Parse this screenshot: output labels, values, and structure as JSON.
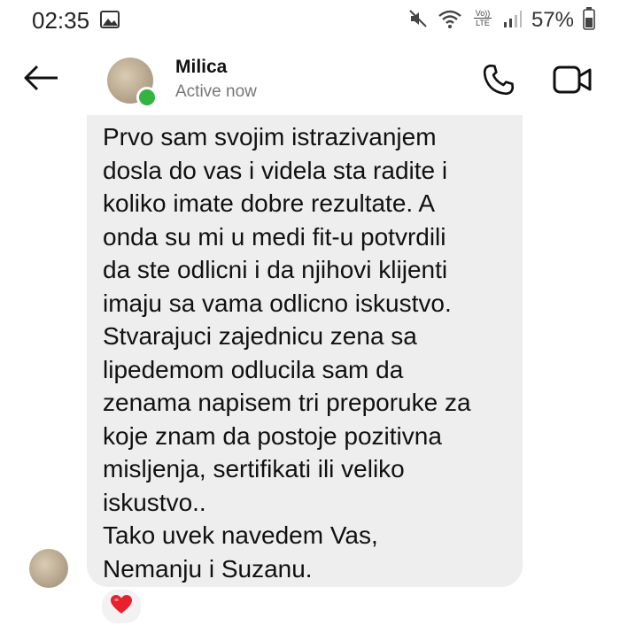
{
  "status_bar": {
    "time": "02:35",
    "battery_percent": "57%",
    "icons": [
      "gallery-icon",
      "mute-icon",
      "wifi-icon",
      "volte-icon",
      "signal-icon",
      "battery-icon"
    ]
  },
  "header": {
    "contact_name": "Milica",
    "status": "Active now",
    "online": true,
    "icons": [
      "back-arrow-icon",
      "phone-icon",
      "video-camera-icon"
    ]
  },
  "message": {
    "lines": [
      "Prvo sam svojim istrazivanjem",
      "dosla do vas i videla sta radite i",
      "koliko imate dobre rezultate. A",
      "onda su mi u medi fit-u potvrdili",
      "da ste odlicni i da njihovi klijenti",
      "imaju sa vama odlicno iskustvo.",
      "Stvarajuci zajednicu zena sa",
      "lipedemom odlucila sam da",
      "zenama napisem tri preporuke za",
      "koje znam da postoje pozitivna",
      "misljenja, sertifikati ili veliko",
      "iskustvo..",
      "Tako uvek navedem Vas,",
      "Nemanju i Suzanu."
    ],
    "reaction": "❤️"
  },
  "colors": {
    "bubble": "#eeeeee",
    "online": "#31b53f",
    "secondary_text": "#777777"
  }
}
